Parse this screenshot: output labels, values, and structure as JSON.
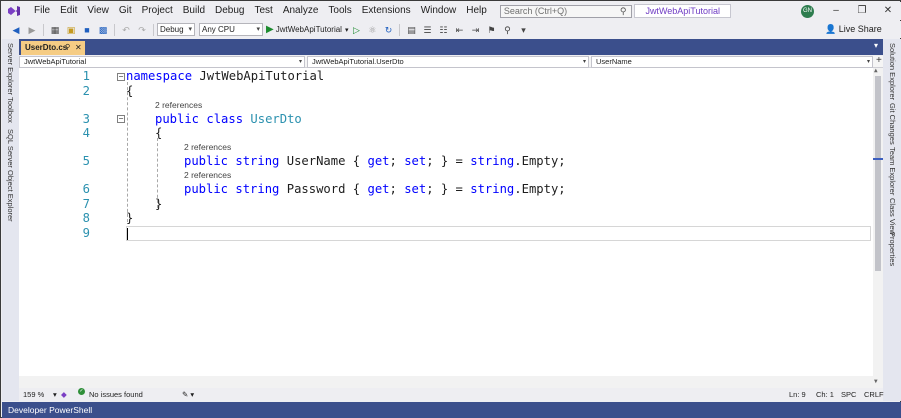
{
  "menu": {
    "items": [
      "File",
      "Edit",
      "View",
      "Git",
      "Project",
      "Build",
      "Debug",
      "Test",
      "Analyze",
      "Tools",
      "Extensions",
      "Window",
      "Help"
    ],
    "search_placeholder": "Search (Ctrl+Q)",
    "solution_title": "JwtWebApiTutorial",
    "avatar_initials": "GN"
  },
  "toolbar": {
    "configuration": "Debug",
    "platform": "Any CPU",
    "startup_project": "JwtWebApiTutorial",
    "live_share": "Live Share"
  },
  "left_tabs": [
    "Server Explorer",
    "Toolbox",
    "SQL Server Object Explorer"
  ],
  "right_tabs": [
    "Solution Explorer",
    "Git Changes",
    "Team Explorer",
    "Class View",
    "Properties"
  ],
  "document_tab": {
    "name": "UserDto.cs"
  },
  "navigation": {
    "project": "JwtWebApiTutorial",
    "type": "JwtWebApiTutorial.UserDto",
    "member": "UserName"
  },
  "code": {
    "line_numbers": [
      "1",
      "2",
      "3",
      "4",
      "5",
      "6",
      "7",
      "8",
      "9"
    ],
    "ref_label": "2 references",
    "namespace_kw": "namespace",
    "namespace_name": "JwtWebApiTutorial",
    "open_brace": "{",
    "close_brace": "}",
    "public_kw": "public",
    "class_kw": "class",
    "class_name": "UserDto",
    "string_kw": "string",
    "prop1_name": "UserName",
    "prop2_name": "Password",
    "get_kw": "get",
    "set_kw": "set",
    "accessor_open": "{ ",
    "sep1": "; ",
    "sep2": "; } = ",
    "empty_suffix": ".Empty;"
  },
  "status": {
    "zoom": "159 %",
    "issues": "No issues found",
    "line": "Ln: 9",
    "col": "Ch: 1",
    "spc": "SPC",
    "crlf": "CRLF"
  },
  "bottom_panel": {
    "label": "Developer PowerShell"
  },
  "colors": {
    "keyword": "#0000ff",
    "type": "#2b91af",
    "tab_strip": "#3b4f8c",
    "active_tab": "#f5cc84"
  }
}
